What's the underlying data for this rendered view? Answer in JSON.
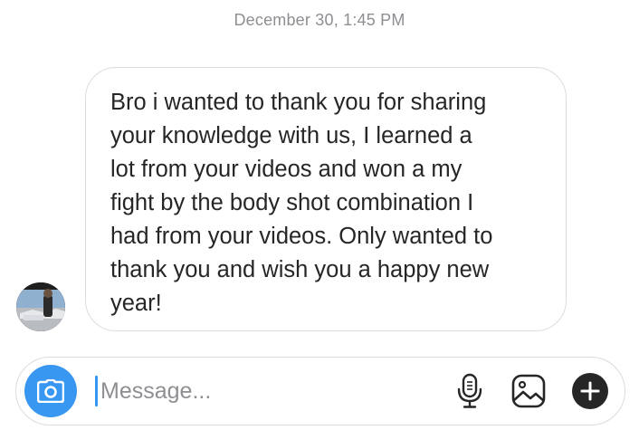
{
  "thread": {
    "timestamp": "December 30, 1:45 PM",
    "message": {
      "text": "Bro i wanted to thank you for sharing\nyour knowledge with us, I learned a\nlot from your videos and won a my\nfight by the body shot combination I\nhad from your videos. Only wanted to\nthank you and wish you a happy new\nyear!"
    }
  },
  "composer": {
    "placeholder": "Message...",
    "value": "",
    "icons": {
      "camera": "camera-icon",
      "mic": "microphone-icon",
      "gallery": "gallery-icon",
      "more": "plus-icon"
    }
  },
  "colors": {
    "accent": "#3897f0",
    "bubble_border": "#dbdbdb",
    "text": "#262626",
    "muted": "#8e8e93"
  }
}
